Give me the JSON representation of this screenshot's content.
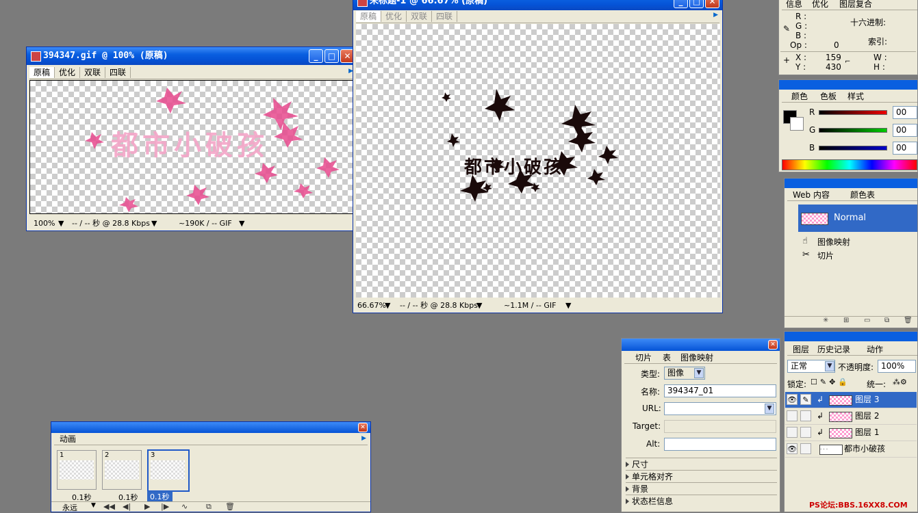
{
  "win_gif": {
    "title": "394347.gif @ 100% (原稿)",
    "tabs": [
      "原稿",
      "优化",
      "双联",
      "四联"
    ],
    "status_zoom": "100%",
    "status_time": "-- / -- 秒 @ 28.8 Kbps",
    "status_size": "~190K / -- GIF",
    "canvas_text": "都市小破孩"
  },
  "win_untitled": {
    "title": "未标题-1 @ 66.67% (原稿)",
    "tabs": [
      "原稿",
      "优化",
      "双联",
      "四联"
    ],
    "status_zoom": "66.67%",
    "status_time": "-- / -- 秒 @ 28.8 Kbps",
    "status_size": "~1.1M / -- GIF",
    "canvas_text": "都市小破孩"
  },
  "info_panel": {
    "tabs": [
      "信息",
      "优化",
      "图层复合"
    ],
    "r": "R :",
    "g": "G :",
    "b": "B :",
    "op": "Op :",
    "op_val": "0",
    "hex_label": "十六进制:",
    "index_label": "索引:",
    "x": "X :",
    "x_val": "159",
    "y": "Y :",
    "y_val": "430",
    "w": "W :",
    "h": "H :"
  },
  "color_panel": {
    "tabs": [
      "颜色",
      "色板",
      "样式"
    ],
    "r_label": "R",
    "g_label": "G",
    "b_label": "B",
    "r_val": "00",
    "g_val": "00",
    "b_val": "00",
    "colors": {
      "r": "#d00000",
      "g": "#00a000",
      "b": "#0000c0"
    }
  },
  "web_panel": {
    "tabs": [
      "Web 内容",
      "颜色表"
    ],
    "normal": "Normal",
    "item_map": "图像映射",
    "item_slice": "切片"
  },
  "slice_panel": {
    "tabs": [
      "切片",
      "表",
      "图像映射"
    ],
    "type_label": "类型:",
    "type_value": "图像",
    "name_label": "名称:",
    "name_value": "394347_01",
    "url_label": "URL:",
    "url_value": "",
    "target_label": "Target:",
    "alt_label": "Alt:",
    "alt_value": "",
    "sections": [
      "尺寸",
      "单元格对齐",
      "背景",
      "状态栏信息"
    ]
  },
  "layers_panel": {
    "tabs": [
      "图层",
      "历史记录",
      "动作"
    ],
    "blend_mode": "正常",
    "opacity_label": "不透明度:",
    "opacity_value": "100%",
    "lock_label": "锁定:",
    "unify_label": "统一:",
    "layers": [
      "图层 3",
      "图层 2",
      "图层 1",
      "都市小破孩"
    ]
  },
  "animation_panel": {
    "tab": "动画",
    "frames": [
      {
        "num": "1",
        "delay": "0.1秒"
      },
      {
        "num": "2",
        "delay": "0.1秒"
      },
      {
        "num": "3",
        "delay": "0.1秒"
      }
    ],
    "loop": "永远"
  },
  "watermark": "PS论坛:BBS.16XX8.COM"
}
